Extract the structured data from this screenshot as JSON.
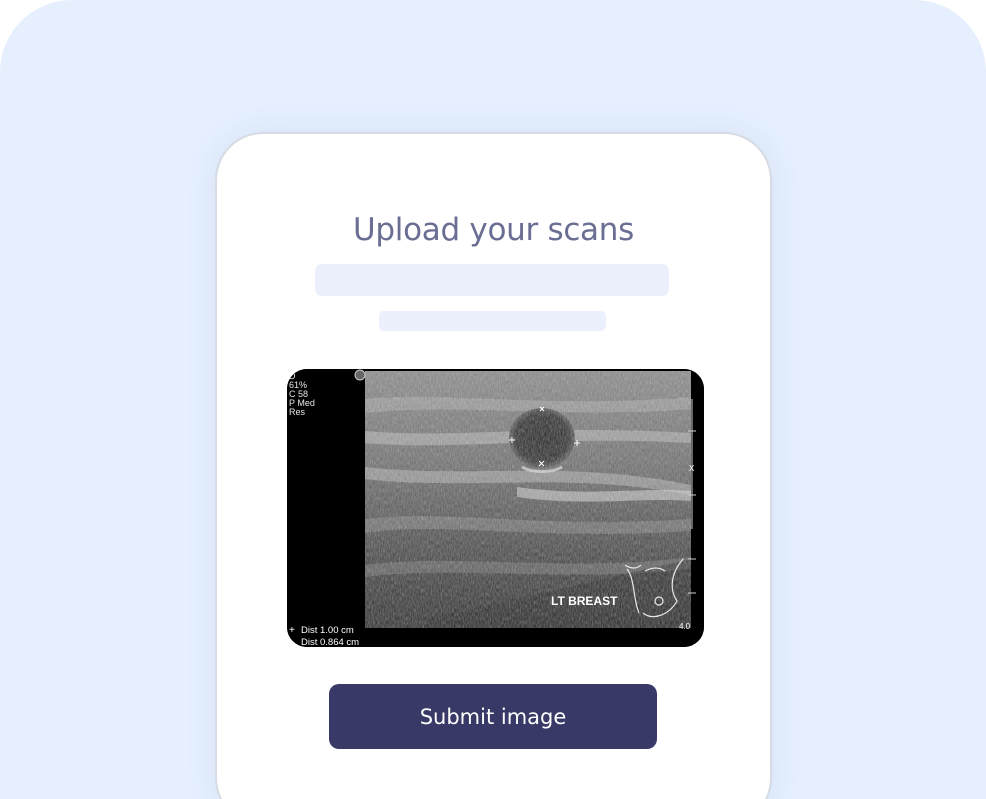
{
  "upload": {
    "title": "Upload your scans",
    "submit_label": "Submit image"
  },
  "scan": {
    "settings": [
      "D",
      "61%",
      "C 58",
      "P Med",
      "Res"
    ],
    "label": "LT BREAST",
    "dist_1": "Dist   1.00 cm",
    "dist_2": "Dist  0.864 cm",
    "depth": "4.0",
    "marker": "X"
  },
  "colors": {
    "background": "#e5effd",
    "button": "#383966",
    "title": "#6a6e92",
    "placeholder": "#eceffc"
  }
}
